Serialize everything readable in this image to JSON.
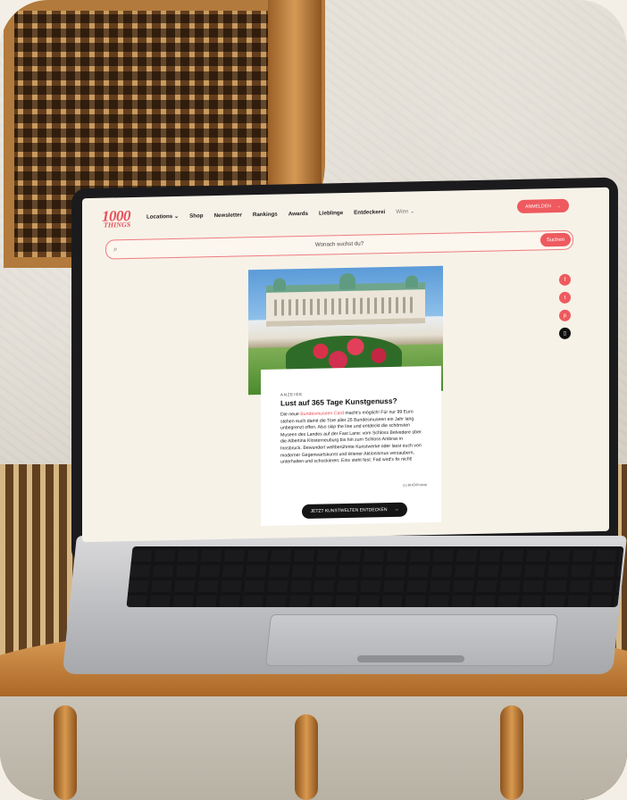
{
  "site": {
    "logo_number": "1000",
    "logo_word": "THINGS",
    "nav": [
      "Locations ⌄",
      "Shop",
      "Newsletter",
      "Rankings",
      "Awards",
      "Lieblinge",
      "Entdeckerei"
    ],
    "city": "Wien ⌄",
    "login_label": "ANMELDEN",
    "search_placeholder": "Wonach suchst du?",
    "search_button": "Suchen"
  },
  "article": {
    "tag": "ANZEIGE",
    "title": "Lust auf 365 Tage Kunstgenuss?",
    "body_before": "Die neue ",
    "body_highlight": "Bundesmuseen Card",
    "body_after": " macht's möglich! Für nur 99 Euro stehen euch damit die Tore aller 25 Bundesmuseen ein Jahr lang unbegrenzt offen. Also skip the line und entdeckt die schönsten Museen des Landes auf der Fast Lane: vom Schloss Belvedere über die Albertina Klosterneuburg bis hin zum Schloss Ambras in Innsbruck. Bewundert weltberühmte Kunstwerke oder lasst euch von moderner Gegenwartskunst und Wiener Aktionismus verzaubern, unterhalten und schockieren. Eins steht fest: Fad wird's fix nicht!",
    "credit": "(c) BHÖ/Prokop",
    "cta": "JETZT KUNSTWELTEN ENTDECKEN"
  },
  "social": [
    "f",
    "t",
    "p",
    "▯"
  ],
  "colors": {
    "accent": "#ee5a5f",
    "page_bg": "#f7f2e8"
  }
}
